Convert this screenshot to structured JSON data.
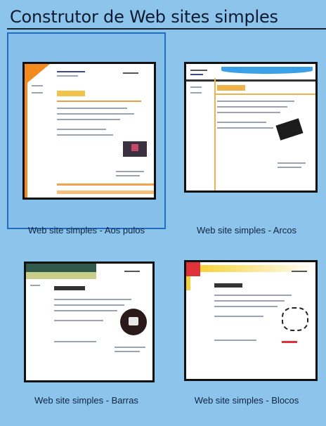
{
  "header": {
    "title": "Construtor de Web sites simples"
  },
  "templates": [
    {
      "label": "Web site simples - Aos pulos",
      "selected": true
    },
    {
      "label": "Web site simples - Arcos",
      "selected": false
    },
    {
      "label": "Web site simples - Barras",
      "selected": false
    },
    {
      "label": "Web site simples - Blocos",
      "selected": false
    }
  ],
  "colors": {
    "background": "#8cc4ec",
    "selection_border": "#1f6fbd",
    "title_text": "#0d1a30"
  }
}
